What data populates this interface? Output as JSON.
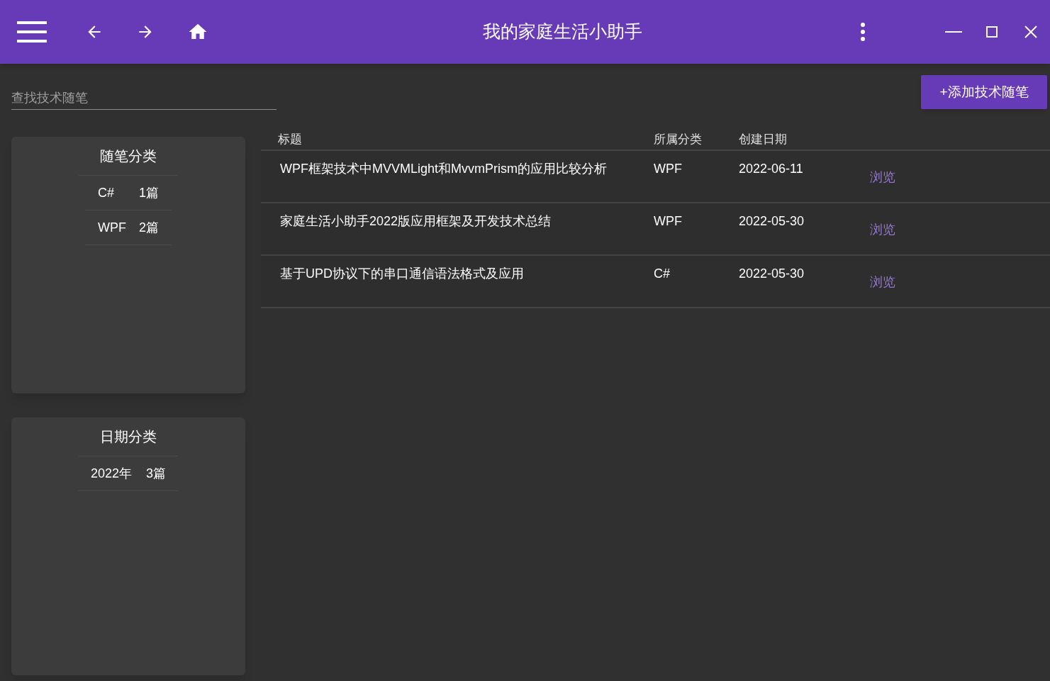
{
  "window": {
    "title": "我的家庭生活小助手"
  },
  "search": {
    "placeholder": "查找技术随笔"
  },
  "add_button": "+添加技术随笔",
  "category_panel": {
    "title": "随笔分类",
    "items": [
      {
        "name": "C#",
        "count": "1篇"
      },
      {
        "name": "WPF",
        "count": "2篇"
      }
    ]
  },
  "date_panel": {
    "title": "日期分类",
    "items": [
      {
        "name": "2022年",
        "count": "3篇"
      }
    ]
  },
  "table": {
    "columns": [
      "标题",
      "所属分类",
      "创建日期"
    ],
    "rows": [
      {
        "title": "WPF框架技术中MVVMLight和MvvmPrism的应用比较分析",
        "category": "WPF",
        "date": "2022-06-11",
        "action": "浏览"
      },
      {
        "title": "家庭生活小助手2022版应用框架及开发技术总结",
        "category": "WPF",
        "date": "2022-05-30",
        "action": "浏览"
      },
      {
        "title": "基于UPD协议下的串口通信语法格式及应用",
        "category": "C#",
        "date": "2022-05-30",
        "action": "浏览"
      }
    ]
  }
}
